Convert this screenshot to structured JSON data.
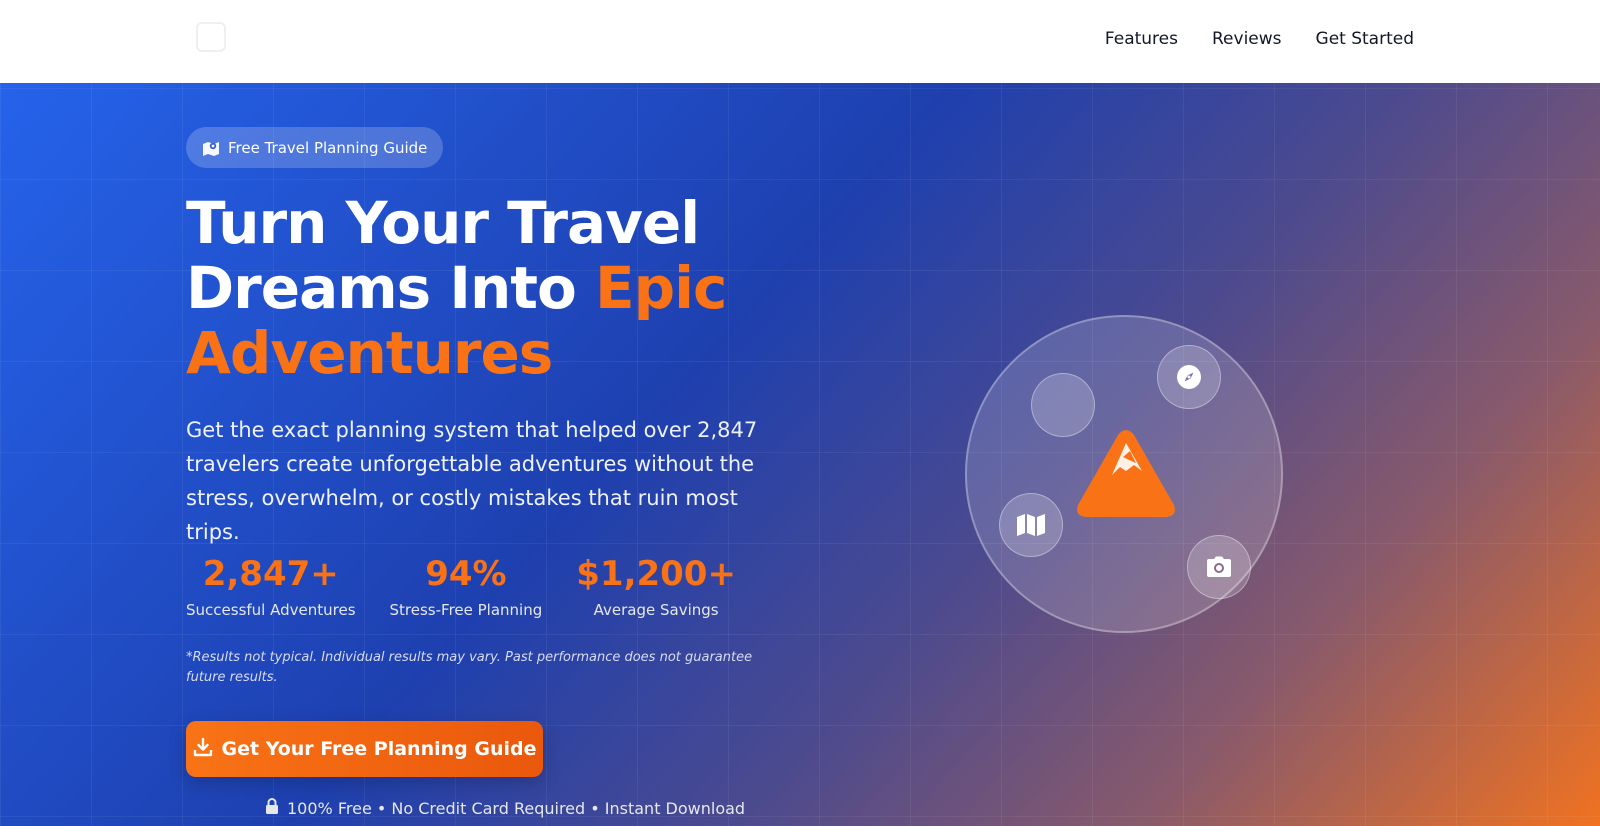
{
  "nav": {
    "links": [
      "Features",
      "Reviews",
      "Get Started"
    ]
  },
  "hero": {
    "badge": "Free Travel Planning Guide",
    "headline_white": "Turn Your Travel Dreams Into ",
    "headline_accent": "Epic Adventures",
    "subtext": "Get the exact planning system that helped over 2,847 travelers create unforgettable adventures without the stress, overwhelm, or costly mistakes that ruin most trips.",
    "stats": [
      {
        "value": "2,847+",
        "label": "Successful Adventures"
      },
      {
        "value": "94%",
        "label": "Stress-Free Planning"
      },
      {
        "value": "$1,200+",
        "label": "Average Savings"
      }
    ],
    "disclaimer": "*Results not typical. Individual results may vary. Past performance does not guarantee future results.",
    "cta_label": "Get Your Free Planning Guide",
    "assurance": "100% Free • No Credit Card Required • Instant Download"
  },
  "colors": {
    "accent": "#f97316",
    "primary": "#2563eb",
    "dark_blue": "#1e40af"
  },
  "icons": [
    "map-marker-icon",
    "download-icon",
    "lock-icon",
    "mountain-icon",
    "compass-icon",
    "map-icon",
    "camera-icon"
  ]
}
